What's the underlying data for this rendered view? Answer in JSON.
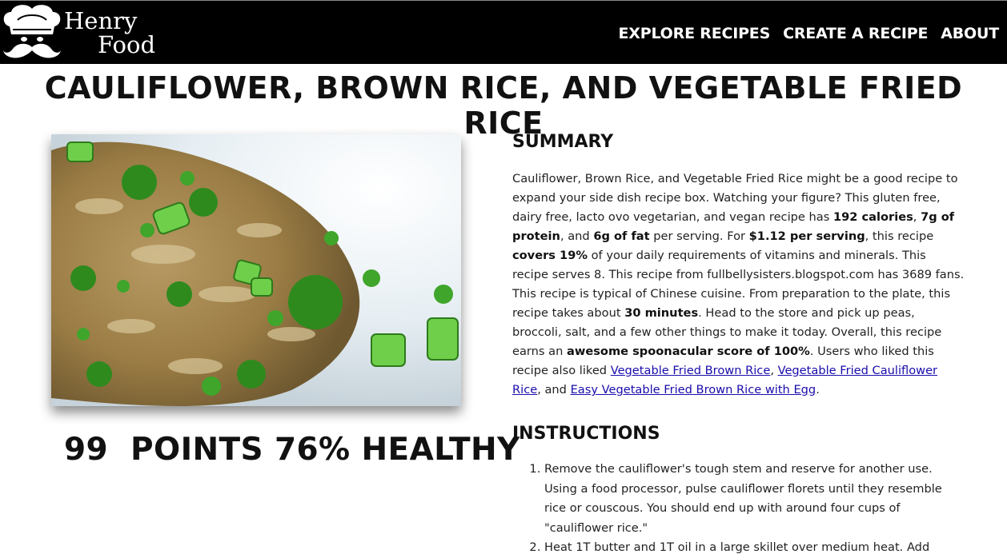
{
  "brand": {
    "line1": "Henry",
    "line2": "Food"
  },
  "nav": {
    "links": [
      "EXPLORE RECIPES",
      "CREATE A RECIPE",
      "ABOUT"
    ]
  },
  "recipe": {
    "title": "CAULIFLOWER, BROWN RICE, AND VEGETABLE FRIED RICE",
    "score_text": "99  POINTS 76% HEALTHY"
  },
  "summary": {
    "heading": "SUMMARY",
    "t1": "Cauliflower, Brown Rice, and Vegetable Fried Rice might be a good recipe to expand your side dish recipe box. Watching your figure? This gluten free, dairy free, lacto ovo vegetarian, and vegan recipe has ",
    "b1": "192 calories",
    "t2": ", ",
    "b2": "7g of protein",
    "t3": ", and ",
    "b3": "6g of fat",
    "t4": " per serving. For ",
    "b4": "$1.12 per serving",
    "t5": ", this recipe ",
    "b5": "covers 19%",
    "t6": " of your daily requirements of vitamins and minerals. This recipe serves 8. This recipe from fullbellysisters.blogspot.com has 3689 fans. This recipe is typical of Chinese cuisine. From preparation to the plate, this recipe takes about ",
    "b6": "30 minutes",
    "t7": ". Head to the store and pick up peas, broccoli, salt, and a few other things to make it today. Overall, this recipe earns an ",
    "b7": "awesome spoonacular score of 100%",
    "t8": ". Users who liked this recipe also liked ",
    "link1": "Vegetable Fried Brown Rice",
    "t9": ", ",
    "link2": "Vegetable Fried Cauliflower Rice",
    "t10": ", and ",
    "link3": "Easy Vegetable Fried Brown Rice with Egg",
    "t11": "."
  },
  "instructions": {
    "heading": "INSTRUCTIONS",
    "steps": [
      "Remove the cauliflower's tough stem and reserve for another use. Using a food processor, pulse cauliflower florets until they resemble rice or couscous. You should end up with around four cups of \"cauliflower rice.\"",
      "Heat 1T butter and 1T oil in a large skillet over medium heat. Add"
    ]
  },
  "colors": {
    "navbar_bg": "#000000",
    "link": "#1a0dab"
  },
  "icons": {
    "logo": "chef-mustache-icon"
  }
}
